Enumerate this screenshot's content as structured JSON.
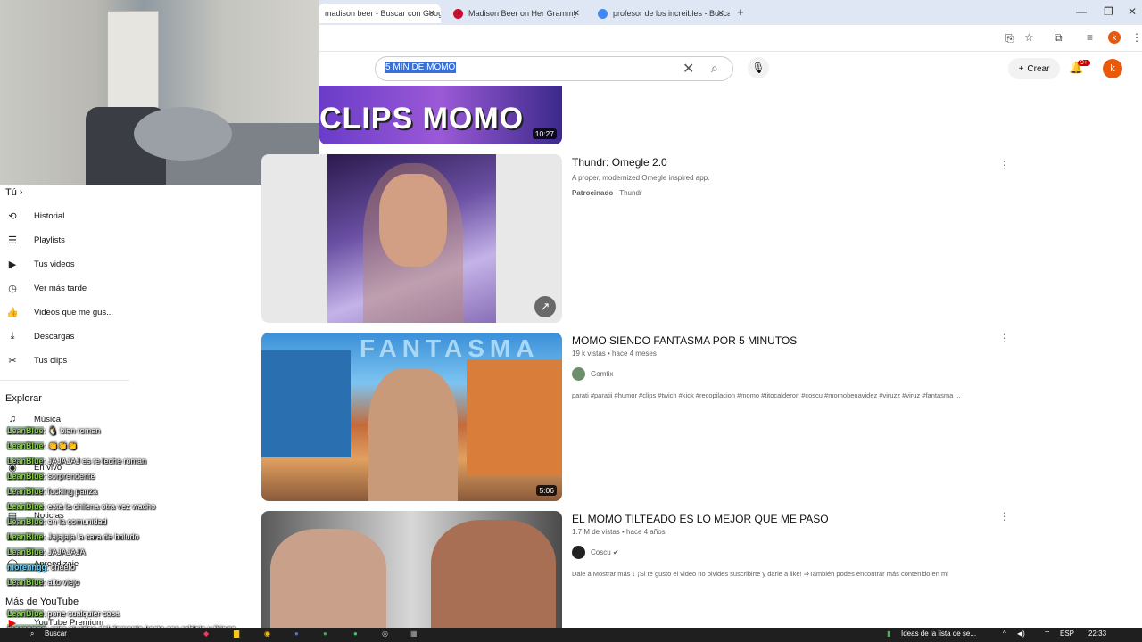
{
  "browser": {
    "tabs": [
      {
        "label": "madison beer - Buscar con Google"
      },
      {
        "label": "Madison Beer on Her Grammy"
      },
      {
        "label": "profesor de los increibles - Buscar"
      }
    ],
    "new_tab_symbol": "+"
  },
  "header": {
    "search_value": "5 MIN DE MOMO",
    "create_label": "Crear",
    "notif_badge": "9+",
    "avatar_letter": "k"
  },
  "sidebar": {
    "you_label": "Tú",
    "items": [
      {
        "label": "Historial",
        "icon": "history-icon"
      },
      {
        "label": "Playlists",
        "icon": "playlist-icon"
      },
      {
        "label": "Tus videos",
        "icon": "video-icon"
      },
      {
        "label": "Ver más tarde",
        "icon": "clock-icon"
      },
      {
        "label": "Videos que me gus...",
        "icon": "like-icon"
      },
      {
        "label": "Descargas",
        "icon": "download-icon"
      },
      {
        "label": "Tus clips",
        "icon": "scissors-icon"
      }
    ],
    "explore_label": "Explorar",
    "explore_items": [
      "Música",
      "En vivo",
      "Noticias",
      "Aprendizaje"
    ],
    "more_label": "Más de YouTube",
    "premium_label": "YouTube Premium"
  },
  "chat": [
    {
      "user": "LeanBlue",
      "msg": ": 🐧 bien roman"
    },
    {
      "user": "LeanBlue",
      "msg": ": 👏👏👏"
    },
    {
      "user": "LeanBlue",
      "msg": ": JAJAJAJ es re leche roman"
    },
    {
      "user": "LeanBlue",
      "msg": ": sorprendente"
    },
    {
      "user": "LeanBlue",
      "msg": ": fucking panza"
    },
    {
      "user": "LeanBlue",
      "msg": ": está la chilena otra vez wacho"
    },
    {
      "user": "LeanBlue",
      "msg": ": en la comunidad"
    },
    {
      "user": "LeanBlue",
      "msg": ": Jajajaja la cara de boludo"
    },
    {
      "user": "LeanBlue",
      "msg": ": JAJAJAJA"
    },
    {
      "user": "morenngg",
      "msg": ": cheeto"
    },
    {
      "user": "LeanBlue",
      "msg": ": alto viejo"
    },
    {
      "user": "LeanBlue",
      "msg": ": pone cualquier cosa"
    },
    {
      "user": "morenngg",
      "msg": ": mira el video del demente kesta con robleis y thiago"
    }
  ],
  "videos": [
    {
      "thumb_text": "CLIPS MOMO",
      "duration": "10:27"
    },
    {
      "title": "Thundr: Omegle 2.0",
      "meta": "A proper, modernized Omegle inspired app.",
      "sponsored": "Patrocinado",
      "channel": "Thundr"
    },
    {
      "title": "MOMO SIENDO FANTASMA POR 5 MINUTOS",
      "meta": "19 k vistas • hace 4 meses",
      "channel": "Gomtix",
      "desc": "parati #paratii #humor #clips #twich #kick #recopilacion #momo #titocalderon #coscu #momobenavidez #viruzz #viruz #fantasma ...",
      "duration": "5:06",
      "thumb_text": "FANTASMA"
    },
    {
      "title": "EL MOMO TILTEADO ES LO MEJOR QUE ME PASO",
      "meta": "1.7 M de vistas • hace 4 años",
      "channel": "Coscu",
      "desc": "Dale a Mostrar más ↓ ¡Si te gusto el video no olvides suscribirte y darle a like! ⇒También podes encontrar más contenido en mi"
    }
  ],
  "taskbar": {
    "search": "Buscar",
    "news": "Ideas de la lista de se...",
    "lang": "ESP",
    "time": "22:33"
  }
}
